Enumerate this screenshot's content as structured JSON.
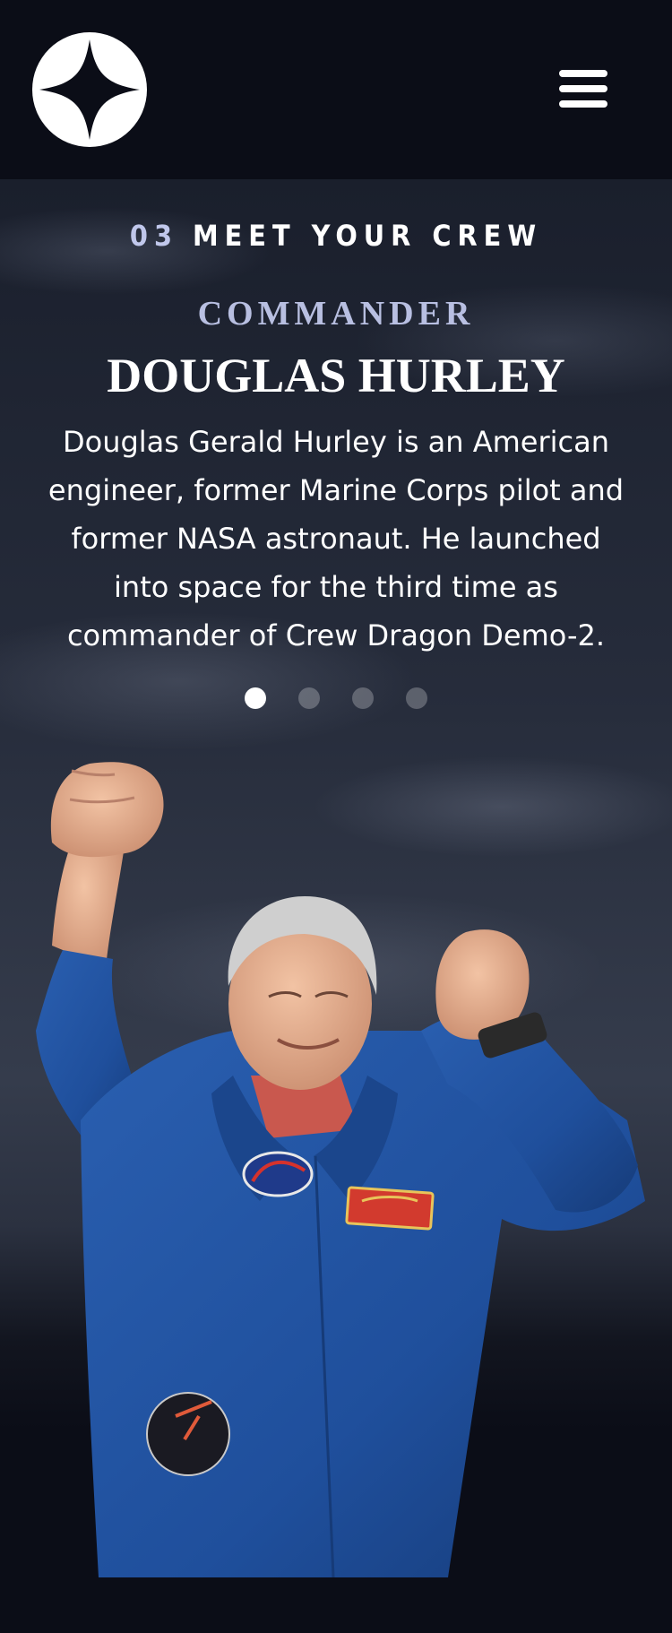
{
  "header": {
    "logo_icon": "four-point-star-icon",
    "menu_icon": "hamburger-menu-icon"
  },
  "page": {
    "heading_number": "03",
    "heading_text": "MEET YOUR CREW"
  },
  "crew": {
    "role": "COMMANDER",
    "name": "DOUGLAS HURLEY",
    "bio": "Douglas Gerald Hurley is an American engineer, former Marine Corps pilot and former NASA astronaut. He launched into space for the third time as commander of Crew Dragon Demo-2.",
    "image_alt": "Douglas Hurley in a blue flight suit raising both fists"
  },
  "carousel": {
    "count": 4,
    "active_index": 0
  },
  "colors": {
    "background": "#0b0d17",
    "accent": "#c9d0f5",
    "text": "#ffffff"
  }
}
